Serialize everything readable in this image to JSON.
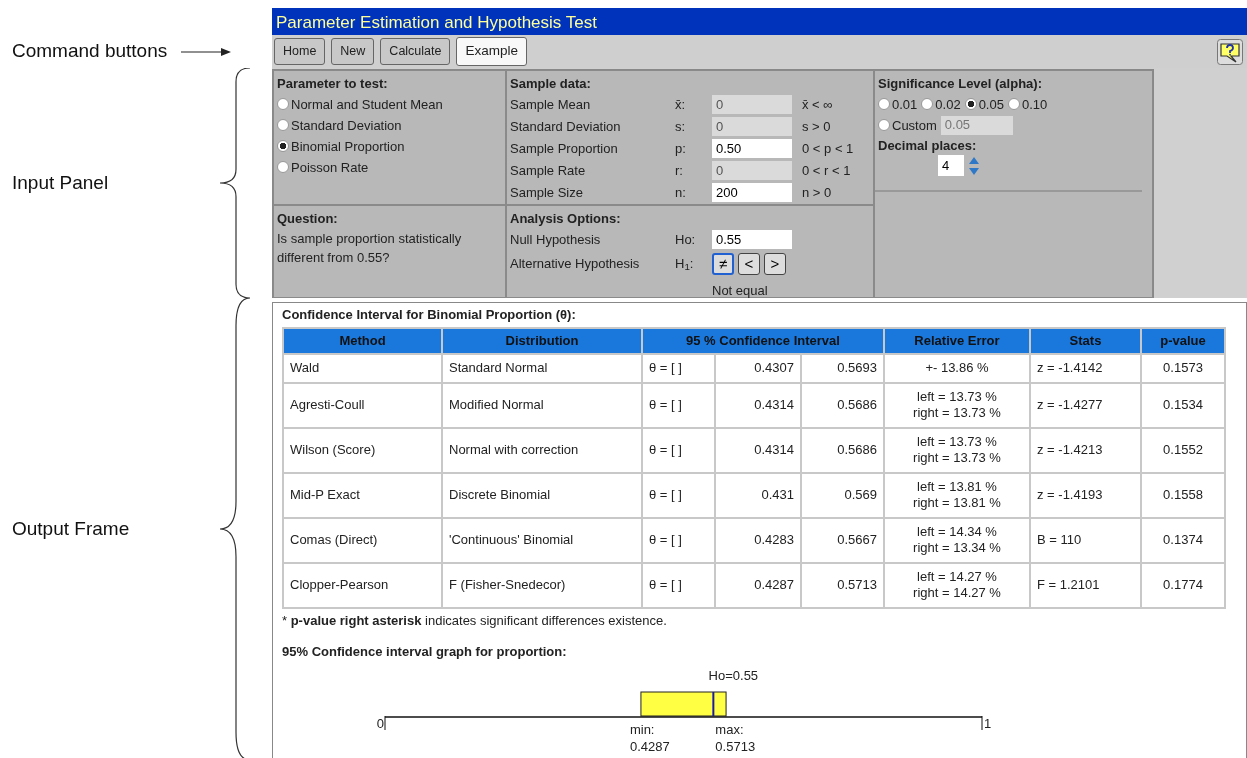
{
  "annotations": [
    {
      "kind": "arrow",
      "text": "Command buttons"
    },
    {
      "kind": "brace",
      "text": "Input Panel"
    },
    {
      "kind": "brace",
      "text": "Output Frame"
    }
  ],
  "window": {
    "title": "Parameter Estimation and Hypothesis Test"
  },
  "toolbar": {
    "buttons": [
      {
        "label": "Home",
        "selected": false
      },
      {
        "label": "New",
        "selected": false
      },
      {
        "label": "Calculate",
        "selected": false
      },
      {
        "label": "Example",
        "selected": true
      }
    ]
  },
  "parameter": {
    "heading": "Parameter to test:",
    "options": [
      {
        "label": "Normal and Student Mean",
        "selected": false
      },
      {
        "label": "Standard Deviation",
        "selected": false
      },
      {
        "label": "Binomial Proportion",
        "selected": true
      },
      {
        "label": "Poisson Rate",
        "selected": false
      }
    ]
  },
  "sample_data": {
    "heading": "Sample data:",
    "rows": [
      {
        "label": "Sample Mean",
        "symbol": "x̄:",
        "value": "0",
        "disabled": true,
        "constraint": "x̄ < ∞"
      },
      {
        "label": "Standard Deviation",
        "symbol": "s:",
        "value": "0",
        "disabled": true,
        "constraint": "s > 0"
      },
      {
        "label": "Sample Proportion",
        "symbol": "p:",
        "value": "0.50",
        "disabled": false,
        "constraint": "0 < p < 1"
      },
      {
        "label": "Sample Rate",
        "symbol": "r:",
        "value": "0",
        "disabled": true,
        "constraint": "0 < r < 1"
      },
      {
        "label": "Sample Size",
        "symbol": "n:",
        "value": "200",
        "disabled": false,
        "constraint": "n > 0"
      }
    ]
  },
  "significance": {
    "heading": "Significance Level (alpha):",
    "options": [
      {
        "label": "0.01",
        "selected": false
      },
      {
        "label": "0.02",
        "selected": false
      },
      {
        "label": "0.05",
        "selected": true
      },
      {
        "label": "0.10",
        "selected": false
      }
    ],
    "custom": {
      "label": "Custom",
      "selected": false,
      "placeholder": "0.05",
      "disabled": true
    },
    "decimal_heading": "Decimal places:",
    "decimal_value": "4"
  },
  "question": {
    "heading": "Question:",
    "text": "Is sample proportion statistically different from 0.55?"
  },
  "analysis": {
    "heading": "Analysis Options:",
    "null_label": "Null Hypothesis",
    "null_symbol": "Ho:",
    "null_value": "0.55",
    "alt_label": "Alternative Hypothesis",
    "alt_symbol": "H$_{1}$:",
    "alt_options": [
      {
        "label": "≠",
        "selected": true
      },
      {
        "label": "<",
        "selected": false
      },
      {
        "label": ">",
        "selected": false
      }
    ],
    "alt_caption": "Not equal"
  },
  "results": {
    "title": "Confidence Interval for Binomial Proportion (θ):",
    "columns": [
      "Method",
      "Distribution",
      "95 % Confidence Interval",
      "Relative Error",
      "Stats",
      "p-value"
    ],
    "rows": [
      {
        "method": "Wald",
        "distribution": "Standard Normal",
        "interval": "θ = [ ]",
        "lower": "0.4307",
        "upper": "0.5693",
        "relative_error": [
          "+- 13.86 %"
        ],
        "stats": "z = -1.4142",
        "p_value": "0.1573"
      },
      {
        "method": "Agresti-Coull",
        "distribution": "Modified Normal",
        "interval": "θ = [ ]",
        "lower": "0.4314",
        "upper": "0.5686",
        "relative_error": [
          "left = 13.73 %",
          "right = 13.73 %"
        ],
        "stats": "z = -1.4277",
        "p_value": "0.1534"
      },
      {
        "method": "Wilson (Score)",
        "distribution": "Normal with correction",
        "interval": "θ = [ ]",
        "lower": "0.4314",
        "upper": "0.5686",
        "relative_error": [
          "left = 13.73 %",
          "right = 13.73 %"
        ],
        "stats": "z = -1.4213",
        "p_value": "0.1552"
      },
      {
        "method": "Mid-P Exact",
        "distribution": "Discrete Binomial",
        "interval": "θ = [ ]",
        "lower": "0.431",
        "upper": "0.569",
        "relative_error": [
          "left = 13.81 %",
          "right = 13.81 %"
        ],
        "stats": "z = -1.4193",
        "p_value": "0.1558"
      },
      {
        "method": "Comas (Direct)",
        "distribution": "'Continuous' Binomial",
        "interval": "θ = [ ]",
        "lower": "0.4283",
        "upper": "0.5667",
        "relative_error": [
          "left = 14.34 %",
          "right = 13.34 %"
        ],
        "stats": "B = 110",
        "p_value": "0.1374"
      },
      {
        "method": "Clopper-Pearson",
        "distribution": "F (Fisher-Snedecor)",
        "interval": "θ = [ ]",
        "lower": "0.4287",
        "upper": "0.5713",
        "relative_error": [
          "left = 14.27 %",
          "right = 14.27 %"
        ],
        "stats": "F = 1.2101",
        "p_value": "0.1774"
      }
    ],
    "footnote": "* **p-value right asterisk** indicates significant differences existence."
  },
  "graph": {
    "title": "95% Confidence interval graph for proportion:",
    "h0_label": "Ho=0.55",
    "axis_min": "0",
    "axis_max": "1",
    "min_label": "min:",
    "min_value": "0.4287",
    "max_label": "max:",
    "max_value": "0.5713"
  }
}
